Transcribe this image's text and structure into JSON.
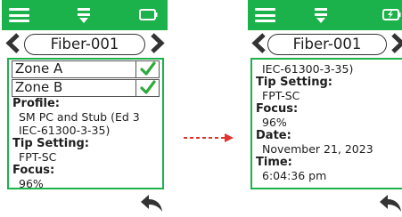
{
  "colors": {
    "accent": "#1bb24b",
    "check": "#2faa3c",
    "arrow": "#e0352f",
    "text": "#1e1e1e"
  },
  "icons": {
    "menu": "hamburger-menu-icon",
    "down": "download-arrow-icon",
    "battery": "battery-icon",
    "battery_charging": "battery-charging-icon",
    "prev": "chevron-left-icon",
    "next": "chevron-right-icon",
    "check": "check-icon",
    "back": "back-arrow-icon",
    "transition": "dashed-right-arrow-icon"
  },
  "left_screen": {
    "title": "Fiber-001",
    "zones": [
      {
        "label": "Zone A",
        "checked": true
      },
      {
        "label": "Zone B",
        "checked": true
      }
    ],
    "profile_label": "Profile:",
    "profile_line1": "SM PC and Stub (Ed 3",
    "profile_line2": "IEC-61300-3-35)",
    "tip_label": "Tip Setting:",
    "tip_value": "FPT-SC",
    "focus_label": "Focus:",
    "focus_value": "96%"
  },
  "right_screen": {
    "title": "Fiber-001",
    "profile_line2": "IEC-61300-3-35)",
    "tip_label": "Tip Setting:",
    "tip_value": "FPT-SC",
    "focus_label": "Focus:",
    "focus_value": "96%",
    "date_label": "Date:",
    "date_value": "November 21, 2023",
    "time_label": "Time:",
    "time_value": "6:04:36 pm"
  }
}
